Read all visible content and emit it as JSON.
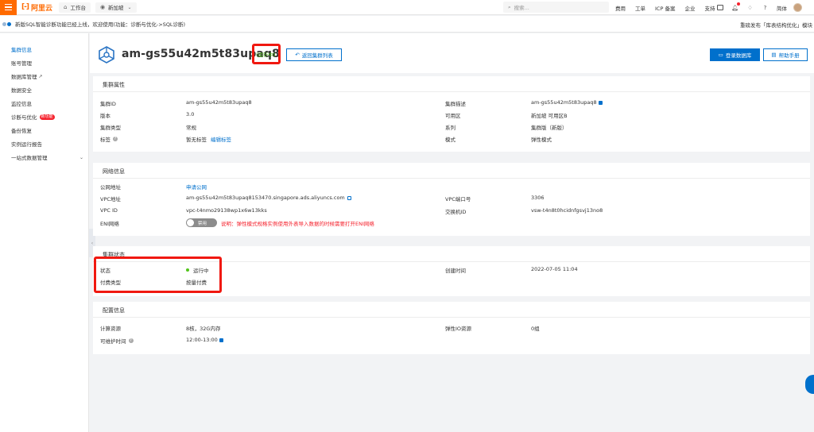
{
  "topbar": {
    "logo_mark": "[-]",
    "logo_text": "阿里云",
    "workbench": "工作台",
    "region": "新加坡",
    "search_placeholder": "搜索...",
    "links": [
      "费用",
      "工单",
      "ICP 备案",
      "企业",
      "支持"
    ],
    "lang": "简体"
  },
  "notice": {
    "left": "新版SQL智能诊断功能已经上线，欢迎使用(功能：诊断与优化->SQL诊断)",
    "right": "重磅发布「库表结构优化」模块"
  },
  "sidebar": {
    "items": [
      {
        "label": "集群信息"
      },
      {
        "label": "账号管理"
      },
      {
        "label": "数据库管理"
      },
      {
        "label": "数据安全"
      },
      {
        "label": "监控信息"
      },
      {
        "label": "诊断与优化",
        "badge": "新功能"
      },
      {
        "label": "备份恢复"
      },
      {
        "label": "实例运行报告"
      },
      {
        "label": "一站式数据管理"
      }
    ]
  },
  "header": {
    "cluster_id": "am-gs55u42m5t83upaq8",
    "status": "运行中",
    "back_button": "返回集群列表",
    "login_button": "登录数据库",
    "help_button": "帮助手册"
  },
  "basic": {
    "title": "集群属性",
    "cluster_id_label": "集群ID",
    "cluster_id": "am-gs55u42m5t83upaq8",
    "version_label": "版本",
    "version": "3.0",
    "type_label": "集群类型",
    "type": "常规",
    "tags_label": "标签",
    "tags": "暂无标签",
    "edit_tags": "编辑标签",
    "desc_label": "集群描述",
    "desc": "am-gs55u42m5t83upaq8",
    "zone_label": "可用区",
    "zone": "新加坡 可用区B",
    "series_label": "系列",
    "series": "集群版（新版）",
    "mode_label": "模式",
    "mode": "弹性模式"
  },
  "network": {
    "title": "网络信息",
    "public_label": "公网地址",
    "public": "申请公网",
    "vpc_addr_label": "VPC地址",
    "vpc_addr": "am-gs55u42m5t83upaq8153470.singapore.ads.aliyuncs.com",
    "vpc_id_label": "VPC ID",
    "vpc_id": "vpc-t4nmo29138wp1x6w13kks",
    "eni_label": "ENI网络",
    "eni_toggle": "禁用",
    "eni_note": "说明：弹性模式规格实例使用外表导入数据的时候需要打开ENI网络",
    "vpc_port_label": "VPC端口号",
    "vpc_port": "3306",
    "vswitch_label": "交换机ID",
    "vswitch": "vsw-t4n8t0hcidnfgsvj13no8"
  },
  "status": {
    "title": "集群状态",
    "state_label": "状态",
    "state": "运行中",
    "billing_label": "付费类型",
    "billing": "按量付费",
    "created_label": "创建时间",
    "created": "2022-07-05 11:04"
  },
  "config": {
    "title": "配置信息",
    "compute_label": "计算资源",
    "compute": "8核，32G内存",
    "maint_label": "可维护时间",
    "maint": "12:00-13:00",
    "eio_label": "弹性IO资源",
    "eio": "0组"
  },
  "colors": {
    "accent": "#0070cc",
    "brand": "#ff6a00",
    "running": "#52c41a",
    "highlight": "#f01810",
    "warning": "#f5222d"
  }
}
